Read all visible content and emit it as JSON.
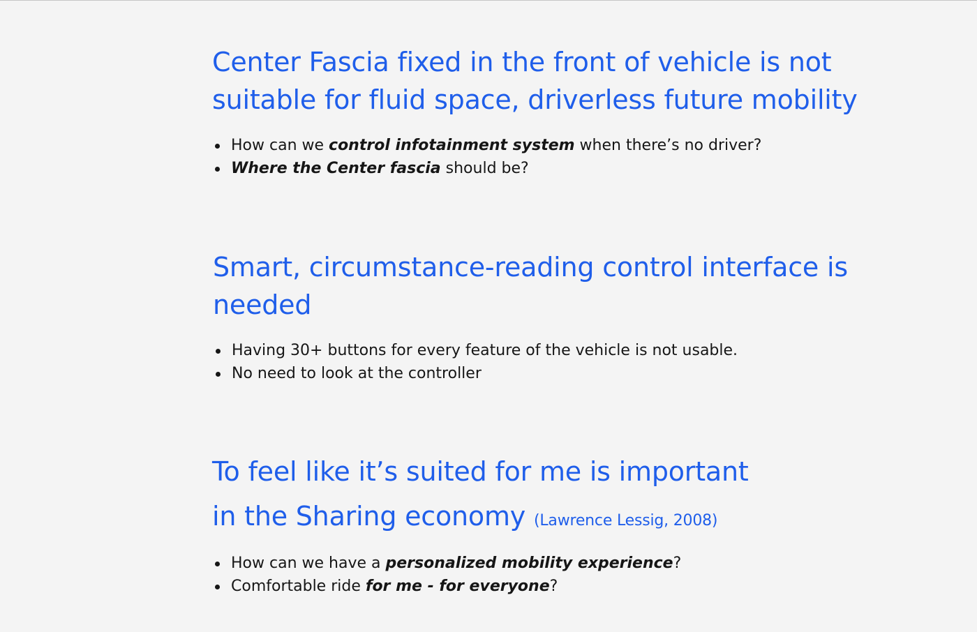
{
  "sections": [
    {
      "heading_line1": "Center Fascia fixed in the front of vehicle is not",
      "heading_line2": "suitable for fluid space, driverless future mobility",
      "bullets": [
        {
          "pre": "How can we ",
          "em": "control infotainment system",
          "post": " when there’s no driver?"
        },
        {
          "pre": "",
          "em": "Where the Center fascia",
          "post": " should be?"
        }
      ]
    },
    {
      "heading_line1": "Smart, circumstance-reading control interface is",
      "heading_line2": "needed",
      "bullets": [
        {
          "text": "Having 30+ buttons for every feature of the vehicle is not usable."
        },
        {
          "text": "No need to look at the controller"
        }
      ]
    },
    {
      "heading_line1": "To feel like it’s suited for me is important",
      "heading_line2": "in the Sharing economy",
      "citation": "(Lawrence Lessig, 2008)",
      "bullets": [
        {
          "pre": "How can we have a ",
          "em": "personalized mobility experience",
          "post": "?"
        },
        {
          "pre": "Comfortable ride ",
          "em": "for me - for everyone",
          "post": "?"
        }
      ]
    }
  ],
  "colors": {
    "background": "#f4f4f4",
    "heading": "#1f5eea",
    "body_text": "#161616"
  }
}
